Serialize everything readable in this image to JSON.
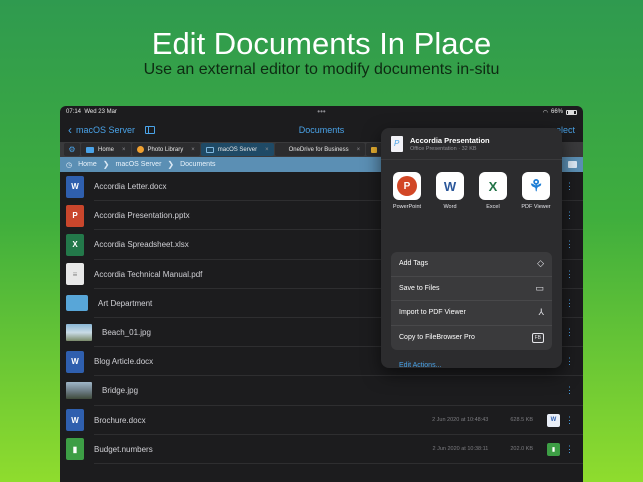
{
  "promo": {
    "headline": "Edit Documents In Place",
    "subline": "Use an external editor to modify documents in-situ"
  },
  "status": {
    "time": "07:14",
    "date": "Wed 23 Mar",
    "battery": "66%"
  },
  "nav": {
    "back_label": "macOS Server",
    "title": "Documents",
    "right_label": "elect"
  },
  "tabs": [
    {
      "label": "Home",
      "icon_color": "#4aa3e8"
    },
    {
      "label": "Photo Library",
      "icon_color": "#f0a030"
    },
    {
      "label": "macOS Server",
      "icon_color": "#7fb8e0"
    },
    {
      "label": "OneDrive for Business",
      "icon_color": ""
    },
    {
      "label": "C",
      "icon_color": "#e8b030"
    }
  ],
  "breadcrumb": [
    "Home",
    "macOS Server",
    "Documents"
  ],
  "files": [
    {
      "name": "Accordia Letter.docx",
      "type": "word",
      "glyph": "W"
    },
    {
      "name": "Accordia Presentation.pptx",
      "type": "ppt",
      "glyph": "P"
    },
    {
      "name": "Accordia Spreadsheet.xlsx",
      "type": "xls",
      "glyph": "X"
    },
    {
      "name": "Accordia Technical Manual.pdf",
      "type": "pdf",
      "glyph": "≡"
    },
    {
      "name": "Art Department",
      "type": "folder",
      "glyph": ""
    },
    {
      "name": "Beach_01.jpg",
      "type": "photo",
      "glyph": ""
    },
    {
      "name": "Blog Article.docx",
      "type": "word",
      "glyph": "W"
    },
    {
      "name": "Bridge.jpg",
      "type": "photo2",
      "glyph": ""
    },
    {
      "name": "Brochure.docx",
      "type": "word",
      "glyph": "W",
      "date": "2 Jun 2020 at 10:48:43",
      "size": "628.5 KB",
      "badge": "word",
      "badge_glyph": "W"
    },
    {
      "name": "Budget.numbers",
      "type": "numbers",
      "glyph": "▮",
      "date": "2 Jun 2020 at 10:38:11",
      "size": "202.0 KB",
      "badge": "numbers",
      "badge_glyph": "▮"
    }
  ],
  "popover": {
    "title": "Accordia Presentation",
    "subtitle": "Office Presentation · 32 KB",
    "apps": [
      {
        "label": "PowerPoint",
        "glyph": "P",
        "kind": "powerpoint"
      },
      {
        "label": "Word",
        "glyph": "W",
        "kind": "word"
      },
      {
        "label": "Excel",
        "glyph": "X",
        "kind": "excel"
      },
      {
        "label": "PDF Viewer",
        "glyph": "⚘",
        "kind": "pdfviewer"
      }
    ],
    "actions": [
      {
        "label": "Add Tags",
        "icon": "tag-icon",
        "glyph": "◇"
      },
      {
        "label": "Save to Files",
        "icon": "folder-icon",
        "glyph": "▭"
      },
      {
        "label": "Import to PDF Viewer",
        "icon": "pdf-viewer-icon",
        "glyph": "⅄"
      },
      {
        "label": "Copy to FileBrowser Pro",
        "icon": "filebrowser-icon",
        "glyph": "FB"
      }
    ],
    "edit_actions": "Edit Actions..."
  }
}
